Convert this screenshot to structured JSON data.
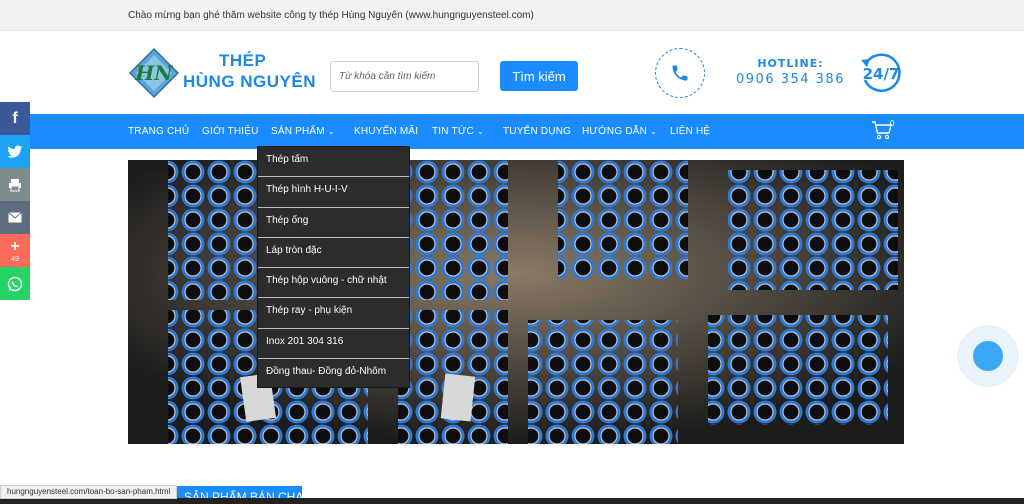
{
  "topbar": {
    "welcome": "Chào mừng bạn ghé thăm website công ty thép Hùng Nguyên (www.hungnguyensteel.com)"
  },
  "logo": {
    "line1": "THÉP",
    "line2": "HÙNG NGUYÊN",
    "mark": "HN"
  },
  "search": {
    "placeholder": "Từ khóa cần tìm kiếm",
    "button": "Tìm kiếm"
  },
  "hotline": {
    "label": "HOTLINE:",
    "number": "0906 354 386"
  },
  "support_badge": "24/7",
  "nav": {
    "items": [
      {
        "label": "TRANG CHỦ"
      },
      {
        "label": "GIỚI THIỆU"
      },
      {
        "label": "SẢN PHẨM"
      },
      {
        "label": "KHUYẾN MÃI"
      },
      {
        "label": "TIN TỨC"
      },
      {
        "label": "TUYỂN DỤNG"
      },
      {
        "label": "HƯỚNG DẪN"
      },
      {
        "label": "LIÊN HỆ"
      }
    ],
    "cart_count": "0"
  },
  "dropdown": {
    "items": [
      {
        "label": "Thép tấm"
      },
      {
        "label": "Thép hình H-U-I-V"
      },
      {
        "label": "Thép ống"
      },
      {
        "label": "Láp tròn đặc"
      },
      {
        "label": "Thép hộp vuông - chữ nhật"
      },
      {
        "label": "Thép ray - phụ kiện"
      },
      {
        "label": "Inox 201 304 316"
      },
      {
        "label": "Đồng thau- Đồng đỏ-Nhôm"
      }
    ]
  },
  "social": {
    "share_count": "49",
    "icons": [
      "facebook-icon",
      "twitter-icon",
      "print-icon",
      "email-icon",
      "plus-icon",
      "whatsapp-icon"
    ],
    "colors": [
      "#3b5998",
      "#1da1f2",
      "#7f8c8d",
      "#5d6d7e",
      "#ff6b5b",
      "#25d366"
    ]
  },
  "status_url": "hungnguyensteel.com/toan-bo-san-pham.html",
  "section_heading": "SẢN PHẨM BÁN CHẠY",
  "colors": {
    "accent": "#1a8cff",
    "dropdown_bg": "#2c2c2c"
  }
}
